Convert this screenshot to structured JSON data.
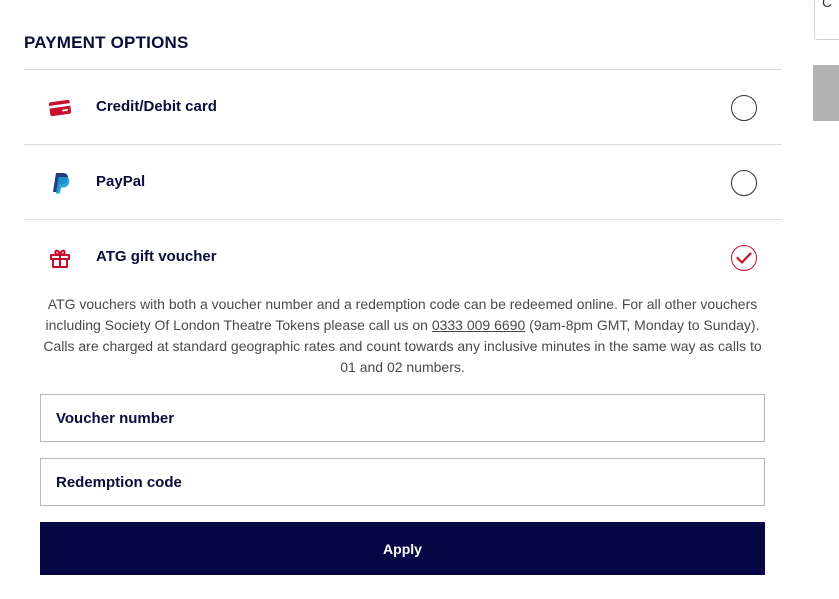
{
  "section": {
    "title": "PAYMENT OPTIONS"
  },
  "options": [
    {
      "label": "Credit/Debit card",
      "icon": "credit-card-icon",
      "checked": false
    },
    {
      "label": "PayPal",
      "icon": "paypal-icon",
      "checked": false
    },
    {
      "label": "ATG gift voucher",
      "icon": "gift-icon",
      "checked": true
    }
  ],
  "voucher_info": {
    "text_before": "ATG vouchers with both a voucher number and a redemption code can be redeemed online. For all other vouchers including Society Of London Theatre Tokens please call us on ",
    "phone": "0333 009 6690",
    "text_after": " (9am-8pm GMT, Monday to Sunday). Calls are charged at standard geographic rates and count towards any inclusive minutes in the same way as calls to 01 and 02 numbers."
  },
  "form": {
    "voucher_placeholder": "Voucher number",
    "voucher_value": "",
    "redemption_placeholder": "Redemption code",
    "redemption_value": "",
    "apply_label": "Apply"
  },
  "colors": {
    "navy": "#0a0c3c",
    "button": "#050844",
    "accent_red": "#c8102e",
    "paypal_dark": "#253b80",
    "paypal_light": "#179bd7"
  },
  "scroll_indicator": {
    "glyph": "C"
  }
}
